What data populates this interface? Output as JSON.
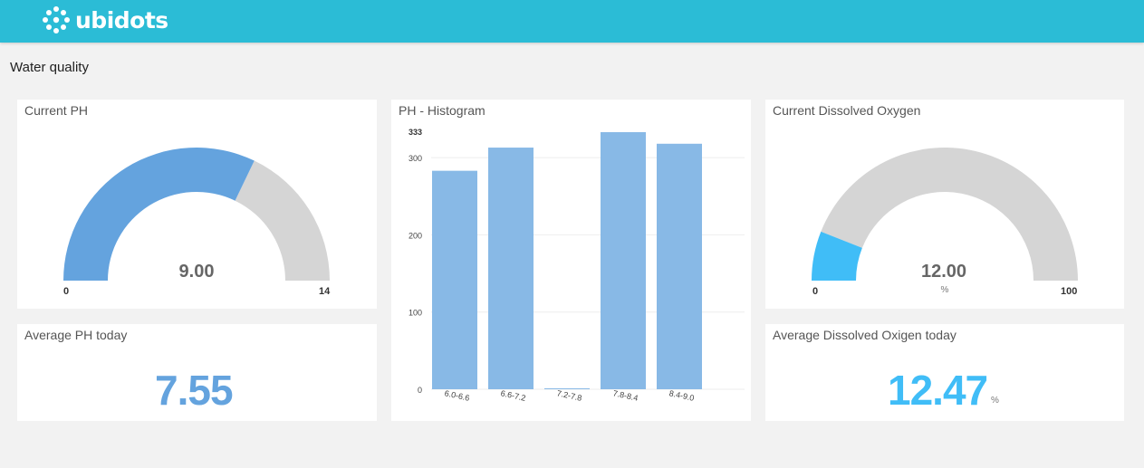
{
  "app": {
    "brand": "ubidots"
  },
  "dashboard": {
    "title": "Water quality"
  },
  "colors": {
    "header": "#2bbcd6",
    "ph_blue": "#64a3de",
    "do_cyan": "#40bdf7",
    "bar_blue": "#88b9e6",
    "gauge_bg": "#d5d5d5"
  },
  "widgets": {
    "current_ph": {
      "title": "Current PH",
      "value": "9.00",
      "value_num": 9,
      "min": "0",
      "max": "14",
      "min_num": 0,
      "max_num": 14,
      "unit": ""
    },
    "avg_ph": {
      "title": "Average PH today",
      "value": "7.55",
      "unit": ""
    },
    "current_do": {
      "title": "Current Dissolved Oxygen",
      "value": "12.00",
      "value_num": 12,
      "min": "0",
      "max": "100",
      "min_num": 0,
      "max_num": 100,
      "unit": "%"
    },
    "avg_do": {
      "title": "Average Dissolved Oxigen today",
      "value": "12.47",
      "unit": "%"
    },
    "ph_histogram": {
      "title": "PH - Histogram"
    }
  },
  "chart_data": {
    "type": "bar",
    "title": "PH - Histogram",
    "categories": [
      "6.0-6.6",
      "6.6-7.2",
      "7.2-7.8",
      "7.8-8.4",
      "8.4-9.0"
    ],
    "values": [
      283,
      313,
      1,
      333,
      318
    ],
    "y_ticks": [
      "0",
      "100",
      "200",
      "300"
    ],
    "y_max_label": "333",
    "ylim": [
      0,
      333
    ],
    "xlabel": "",
    "ylabel": "",
    "grid": true
  }
}
